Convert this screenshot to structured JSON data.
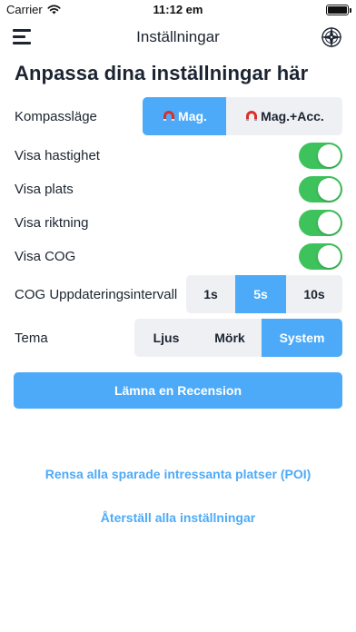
{
  "status_bar": {
    "carrier": "Carrier",
    "time": "11:12 em"
  },
  "nav": {
    "title": "Inställningar",
    "menu_icon": "hamburger-menu-icon",
    "right_icon": "compass-logo-icon"
  },
  "heading": "Anpassa dina inställningar här",
  "compass_mode": {
    "label": "Kompassläge",
    "options": [
      "Mag.",
      "Mag.+Acc."
    ],
    "selected": "Mag.",
    "icon": "magnet-icon"
  },
  "toggles": [
    {
      "label": "Visa hastighet",
      "on": true
    },
    {
      "label": "Visa plats",
      "on": true
    },
    {
      "label": "Visa riktning",
      "on": true
    },
    {
      "label": "Visa COG",
      "on": true
    }
  ],
  "cog_interval": {
    "label": "COG Uppdateringsintervall",
    "options": [
      "1s",
      "5s",
      "10s"
    ],
    "selected": "5s"
  },
  "theme": {
    "label": "Tema",
    "options": [
      "Ljus",
      "Mörk",
      "System"
    ],
    "selected": "System"
  },
  "review_button": "Lämna en Recension",
  "clear_poi_link": "Rensa alla sparade intressanta platser (POI)",
  "reset_link": "Återställ alla inställningar",
  "colors": {
    "accent": "#4daaf8",
    "toggle_on": "#3ec35c",
    "segment_bg": "#eef0f4",
    "text": "#1b2430"
  }
}
